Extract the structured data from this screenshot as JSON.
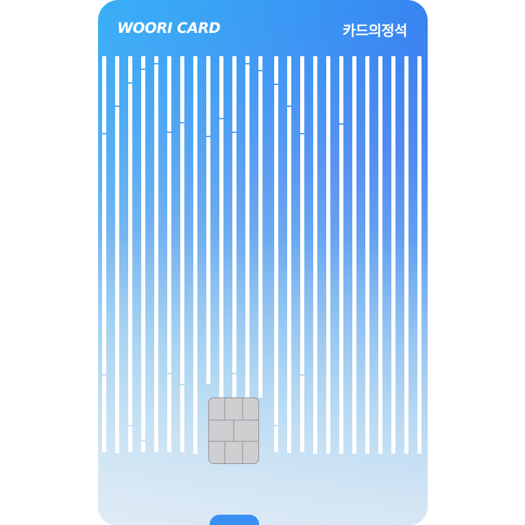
{
  "card": {
    "brand": "WOORI CARD",
    "name": "카드의정석"
  },
  "colors": {
    "gradient_top_right": "#3b63ee",
    "gradient_top_left": "#28d7fa",
    "gradient_bottom": "#e8ecf6",
    "bars": "#ffffff",
    "chip_fill": "#cfcfd2",
    "chip_lines": "#8e8e93",
    "bottom_tab": "#3a8ff5"
  },
  "icons": {
    "chip": "ic-chip-icon"
  }
}
